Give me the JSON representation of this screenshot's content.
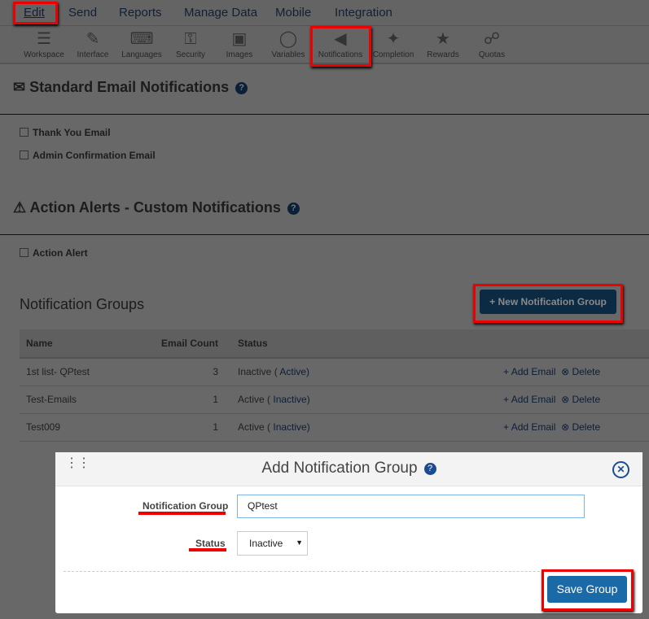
{
  "topnav": [
    "Edit",
    "Send",
    "Reports",
    "Manage Data",
    "Mobile",
    "Integration"
  ],
  "tools": [
    {
      "label": "Workspace",
      "icon": "workspace-icon"
    },
    {
      "label": "Interface",
      "icon": "interface-icon"
    },
    {
      "label": "Languages",
      "icon": "languages-icon"
    },
    {
      "label": "Security",
      "icon": "security-icon"
    },
    {
      "label": "Images",
      "icon": "images-icon"
    },
    {
      "label": "Variables",
      "icon": "variables-icon"
    },
    {
      "label": "Notifications",
      "icon": "megaphone-icon"
    },
    {
      "label": "Completion",
      "icon": "completion-icon"
    },
    {
      "label": "Rewards",
      "icon": "trophy-icon"
    },
    {
      "label": "Quotas",
      "icon": "quotas-icon"
    }
  ],
  "standard": {
    "title": "Standard Email Notifications",
    "items": [
      "Thank You Email",
      "Admin Confirmation Email"
    ]
  },
  "alerts": {
    "title": "Action Alerts - Custom Notifications",
    "items": [
      "Action Alert"
    ]
  },
  "groups": {
    "title": "Notification Groups",
    "new_button": "+ New Notification Group",
    "headers": [
      "Name",
      "Email Count",
      "Status"
    ],
    "rows": [
      {
        "name": "1st list- QPtest",
        "count": "3",
        "status": "Inactive (",
        "toggle": "Active)",
        "add": "Add Email",
        "delete": "Delete"
      },
      {
        "name": "Test-Emails",
        "count": "1",
        "status": "Active (",
        "toggle": "Inactive)",
        "add": "Add Email",
        "delete": "Delete"
      },
      {
        "name": "Test009",
        "count": "1",
        "status": "Active (",
        "toggle": "Inactive)",
        "add": "Add Email",
        "delete": "Delete"
      }
    ]
  },
  "modal": {
    "title": "Add Notification Group",
    "group_label": "Notification Group",
    "group_value": "QPtest",
    "status_label": "Status",
    "status_value": "Inactive",
    "save": "Save Group"
  }
}
